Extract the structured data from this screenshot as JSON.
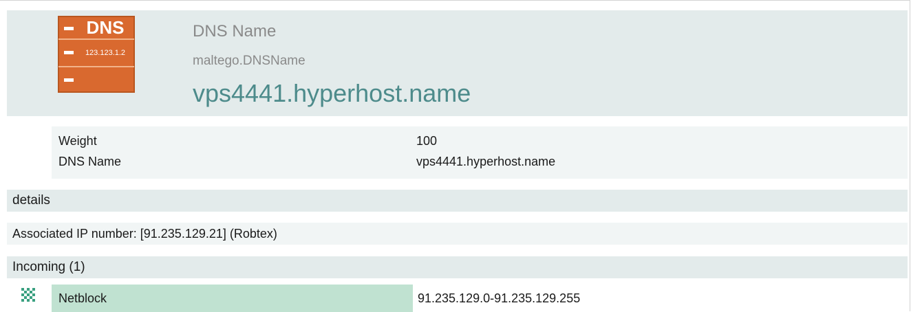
{
  "entity": {
    "icon": "dns-name-icon",
    "icon_text": "DNS",
    "icon_ip": "123.123.1.2",
    "type_label": "DNS Name",
    "type_id": "maltego.DNSName",
    "value": "vps4441.hyperhost.name"
  },
  "properties": [
    {
      "name": "Weight",
      "value": "100"
    },
    {
      "name": "DNS Name",
      "value": "vps4441.hyperhost.name"
    }
  ],
  "details": {
    "title": "details",
    "text": "Associated IP number: [91.235.129.21] (Robtex)"
  },
  "incoming": {
    "title": "Incoming (1)",
    "items": [
      {
        "icon": "netblock-icon",
        "type": "Netblock",
        "value": "91.235.129.0-91.235.129.255"
      }
    ]
  },
  "colors": {
    "header_bg": "#e3ebeb",
    "row_bg": "#f1f5f5",
    "entity_value": "#4d8b8b",
    "icon_orange": "#d9692f",
    "link_highlight": "#c0e2d1"
  }
}
